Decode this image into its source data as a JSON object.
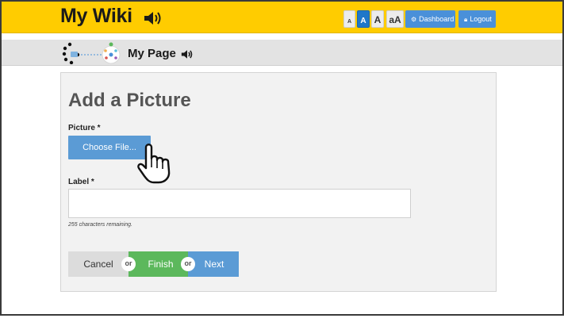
{
  "header": {
    "site_title": "My Wiki",
    "text_size_options": [
      "A",
      "A",
      "A",
      "aA"
    ],
    "dashboard_label": "Dashboard",
    "logout_label": "Logout",
    "dashboard_icon": "cogs-icon",
    "logout_icon": "lock-icon"
  },
  "subheader": {
    "page_name": "My Page"
  },
  "form": {
    "title": "Add a Picture",
    "picture_label": "Picture *",
    "choose_file_label": "Choose File...",
    "label_label": "Label *",
    "label_value": "",
    "chars_remaining": "255 characters remaining.",
    "cancel_label": "Cancel",
    "or_label": "or",
    "finish_label": "Finish",
    "next_label": "Next"
  },
  "colors": {
    "header_bg": "#ffcc00",
    "primary_blue": "#5b9bd5",
    "finish_green": "#5cb85c",
    "active_size": "#1f77c9"
  }
}
